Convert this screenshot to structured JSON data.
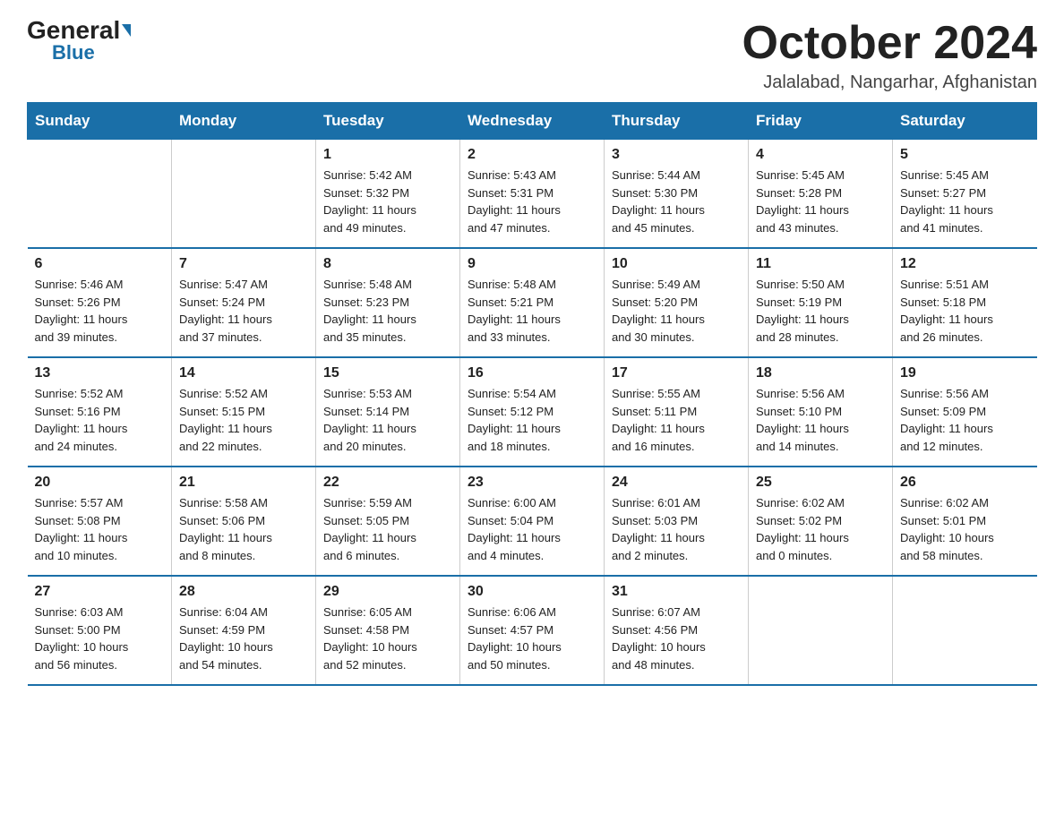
{
  "header": {
    "logo_general": "General",
    "logo_blue": "Blue",
    "month_title": "October 2024",
    "location": "Jalalabad, Nangarhar, Afghanistan"
  },
  "days_of_week": [
    "Sunday",
    "Monday",
    "Tuesday",
    "Wednesday",
    "Thursday",
    "Friday",
    "Saturday"
  ],
  "weeks": [
    [
      {
        "day": "",
        "info": ""
      },
      {
        "day": "",
        "info": ""
      },
      {
        "day": "1",
        "info": "Sunrise: 5:42 AM\nSunset: 5:32 PM\nDaylight: 11 hours\nand 49 minutes."
      },
      {
        "day": "2",
        "info": "Sunrise: 5:43 AM\nSunset: 5:31 PM\nDaylight: 11 hours\nand 47 minutes."
      },
      {
        "day": "3",
        "info": "Sunrise: 5:44 AM\nSunset: 5:30 PM\nDaylight: 11 hours\nand 45 minutes."
      },
      {
        "day": "4",
        "info": "Sunrise: 5:45 AM\nSunset: 5:28 PM\nDaylight: 11 hours\nand 43 minutes."
      },
      {
        "day": "5",
        "info": "Sunrise: 5:45 AM\nSunset: 5:27 PM\nDaylight: 11 hours\nand 41 minutes."
      }
    ],
    [
      {
        "day": "6",
        "info": "Sunrise: 5:46 AM\nSunset: 5:26 PM\nDaylight: 11 hours\nand 39 minutes."
      },
      {
        "day": "7",
        "info": "Sunrise: 5:47 AM\nSunset: 5:24 PM\nDaylight: 11 hours\nand 37 minutes."
      },
      {
        "day": "8",
        "info": "Sunrise: 5:48 AM\nSunset: 5:23 PM\nDaylight: 11 hours\nand 35 minutes."
      },
      {
        "day": "9",
        "info": "Sunrise: 5:48 AM\nSunset: 5:21 PM\nDaylight: 11 hours\nand 33 minutes."
      },
      {
        "day": "10",
        "info": "Sunrise: 5:49 AM\nSunset: 5:20 PM\nDaylight: 11 hours\nand 30 minutes."
      },
      {
        "day": "11",
        "info": "Sunrise: 5:50 AM\nSunset: 5:19 PM\nDaylight: 11 hours\nand 28 minutes."
      },
      {
        "day": "12",
        "info": "Sunrise: 5:51 AM\nSunset: 5:18 PM\nDaylight: 11 hours\nand 26 minutes."
      }
    ],
    [
      {
        "day": "13",
        "info": "Sunrise: 5:52 AM\nSunset: 5:16 PM\nDaylight: 11 hours\nand 24 minutes."
      },
      {
        "day": "14",
        "info": "Sunrise: 5:52 AM\nSunset: 5:15 PM\nDaylight: 11 hours\nand 22 minutes."
      },
      {
        "day": "15",
        "info": "Sunrise: 5:53 AM\nSunset: 5:14 PM\nDaylight: 11 hours\nand 20 minutes."
      },
      {
        "day": "16",
        "info": "Sunrise: 5:54 AM\nSunset: 5:12 PM\nDaylight: 11 hours\nand 18 minutes."
      },
      {
        "day": "17",
        "info": "Sunrise: 5:55 AM\nSunset: 5:11 PM\nDaylight: 11 hours\nand 16 minutes."
      },
      {
        "day": "18",
        "info": "Sunrise: 5:56 AM\nSunset: 5:10 PM\nDaylight: 11 hours\nand 14 minutes."
      },
      {
        "day": "19",
        "info": "Sunrise: 5:56 AM\nSunset: 5:09 PM\nDaylight: 11 hours\nand 12 minutes."
      }
    ],
    [
      {
        "day": "20",
        "info": "Sunrise: 5:57 AM\nSunset: 5:08 PM\nDaylight: 11 hours\nand 10 minutes."
      },
      {
        "day": "21",
        "info": "Sunrise: 5:58 AM\nSunset: 5:06 PM\nDaylight: 11 hours\nand 8 minutes."
      },
      {
        "day": "22",
        "info": "Sunrise: 5:59 AM\nSunset: 5:05 PM\nDaylight: 11 hours\nand 6 minutes."
      },
      {
        "day": "23",
        "info": "Sunrise: 6:00 AM\nSunset: 5:04 PM\nDaylight: 11 hours\nand 4 minutes."
      },
      {
        "day": "24",
        "info": "Sunrise: 6:01 AM\nSunset: 5:03 PM\nDaylight: 11 hours\nand 2 minutes."
      },
      {
        "day": "25",
        "info": "Sunrise: 6:02 AM\nSunset: 5:02 PM\nDaylight: 11 hours\nand 0 minutes."
      },
      {
        "day": "26",
        "info": "Sunrise: 6:02 AM\nSunset: 5:01 PM\nDaylight: 10 hours\nand 58 minutes."
      }
    ],
    [
      {
        "day": "27",
        "info": "Sunrise: 6:03 AM\nSunset: 5:00 PM\nDaylight: 10 hours\nand 56 minutes."
      },
      {
        "day": "28",
        "info": "Sunrise: 6:04 AM\nSunset: 4:59 PM\nDaylight: 10 hours\nand 54 minutes."
      },
      {
        "day": "29",
        "info": "Sunrise: 6:05 AM\nSunset: 4:58 PM\nDaylight: 10 hours\nand 52 minutes."
      },
      {
        "day": "30",
        "info": "Sunrise: 6:06 AM\nSunset: 4:57 PM\nDaylight: 10 hours\nand 50 minutes."
      },
      {
        "day": "31",
        "info": "Sunrise: 6:07 AM\nSunset: 4:56 PM\nDaylight: 10 hours\nand 48 minutes."
      },
      {
        "day": "",
        "info": ""
      },
      {
        "day": "",
        "info": ""
      }
    ]
  ]
}
